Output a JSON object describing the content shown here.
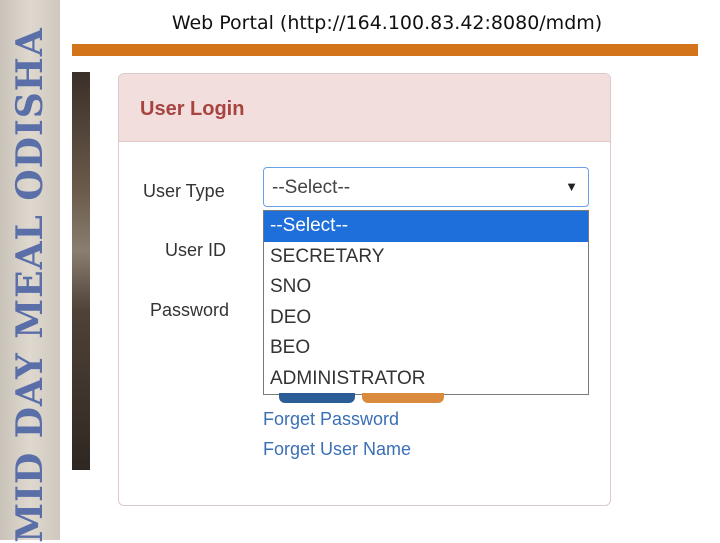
{
  "slide": {
    "title": "Web Portal (http://164.100.83.42:8080/mdm)",
    "side_banner": "MID DAY MEAL ODISHA"
  },
  "login": {
    "title": "User Login",
    "user_type_label": "User Type",
    "user_id_label": "User ID",
    "password_label": "Password",
    "user_type_value": "--Select--",
    "options": [
      "--Select--",
      "SECRETARY",
      "SNO",
      "DEO",
      "BEO",
      "ADMINISTRATOR"
    ],
    "selected_index": 0,
    "forgot_password": "Forget Password",
    "forgot_username": "Forget User Name"
  },
  "colors": {
    "accent_orange": "#d4741a",
    "header_bg": "#f3dede",
    "title_red": "#a6443f",
    "link_blue": "#3b6fb6",
    "selected_blue": "#1e6fd9"
  },
  "icons": {
    "dropdown_caret": "caret-down-icon"
  }
}
